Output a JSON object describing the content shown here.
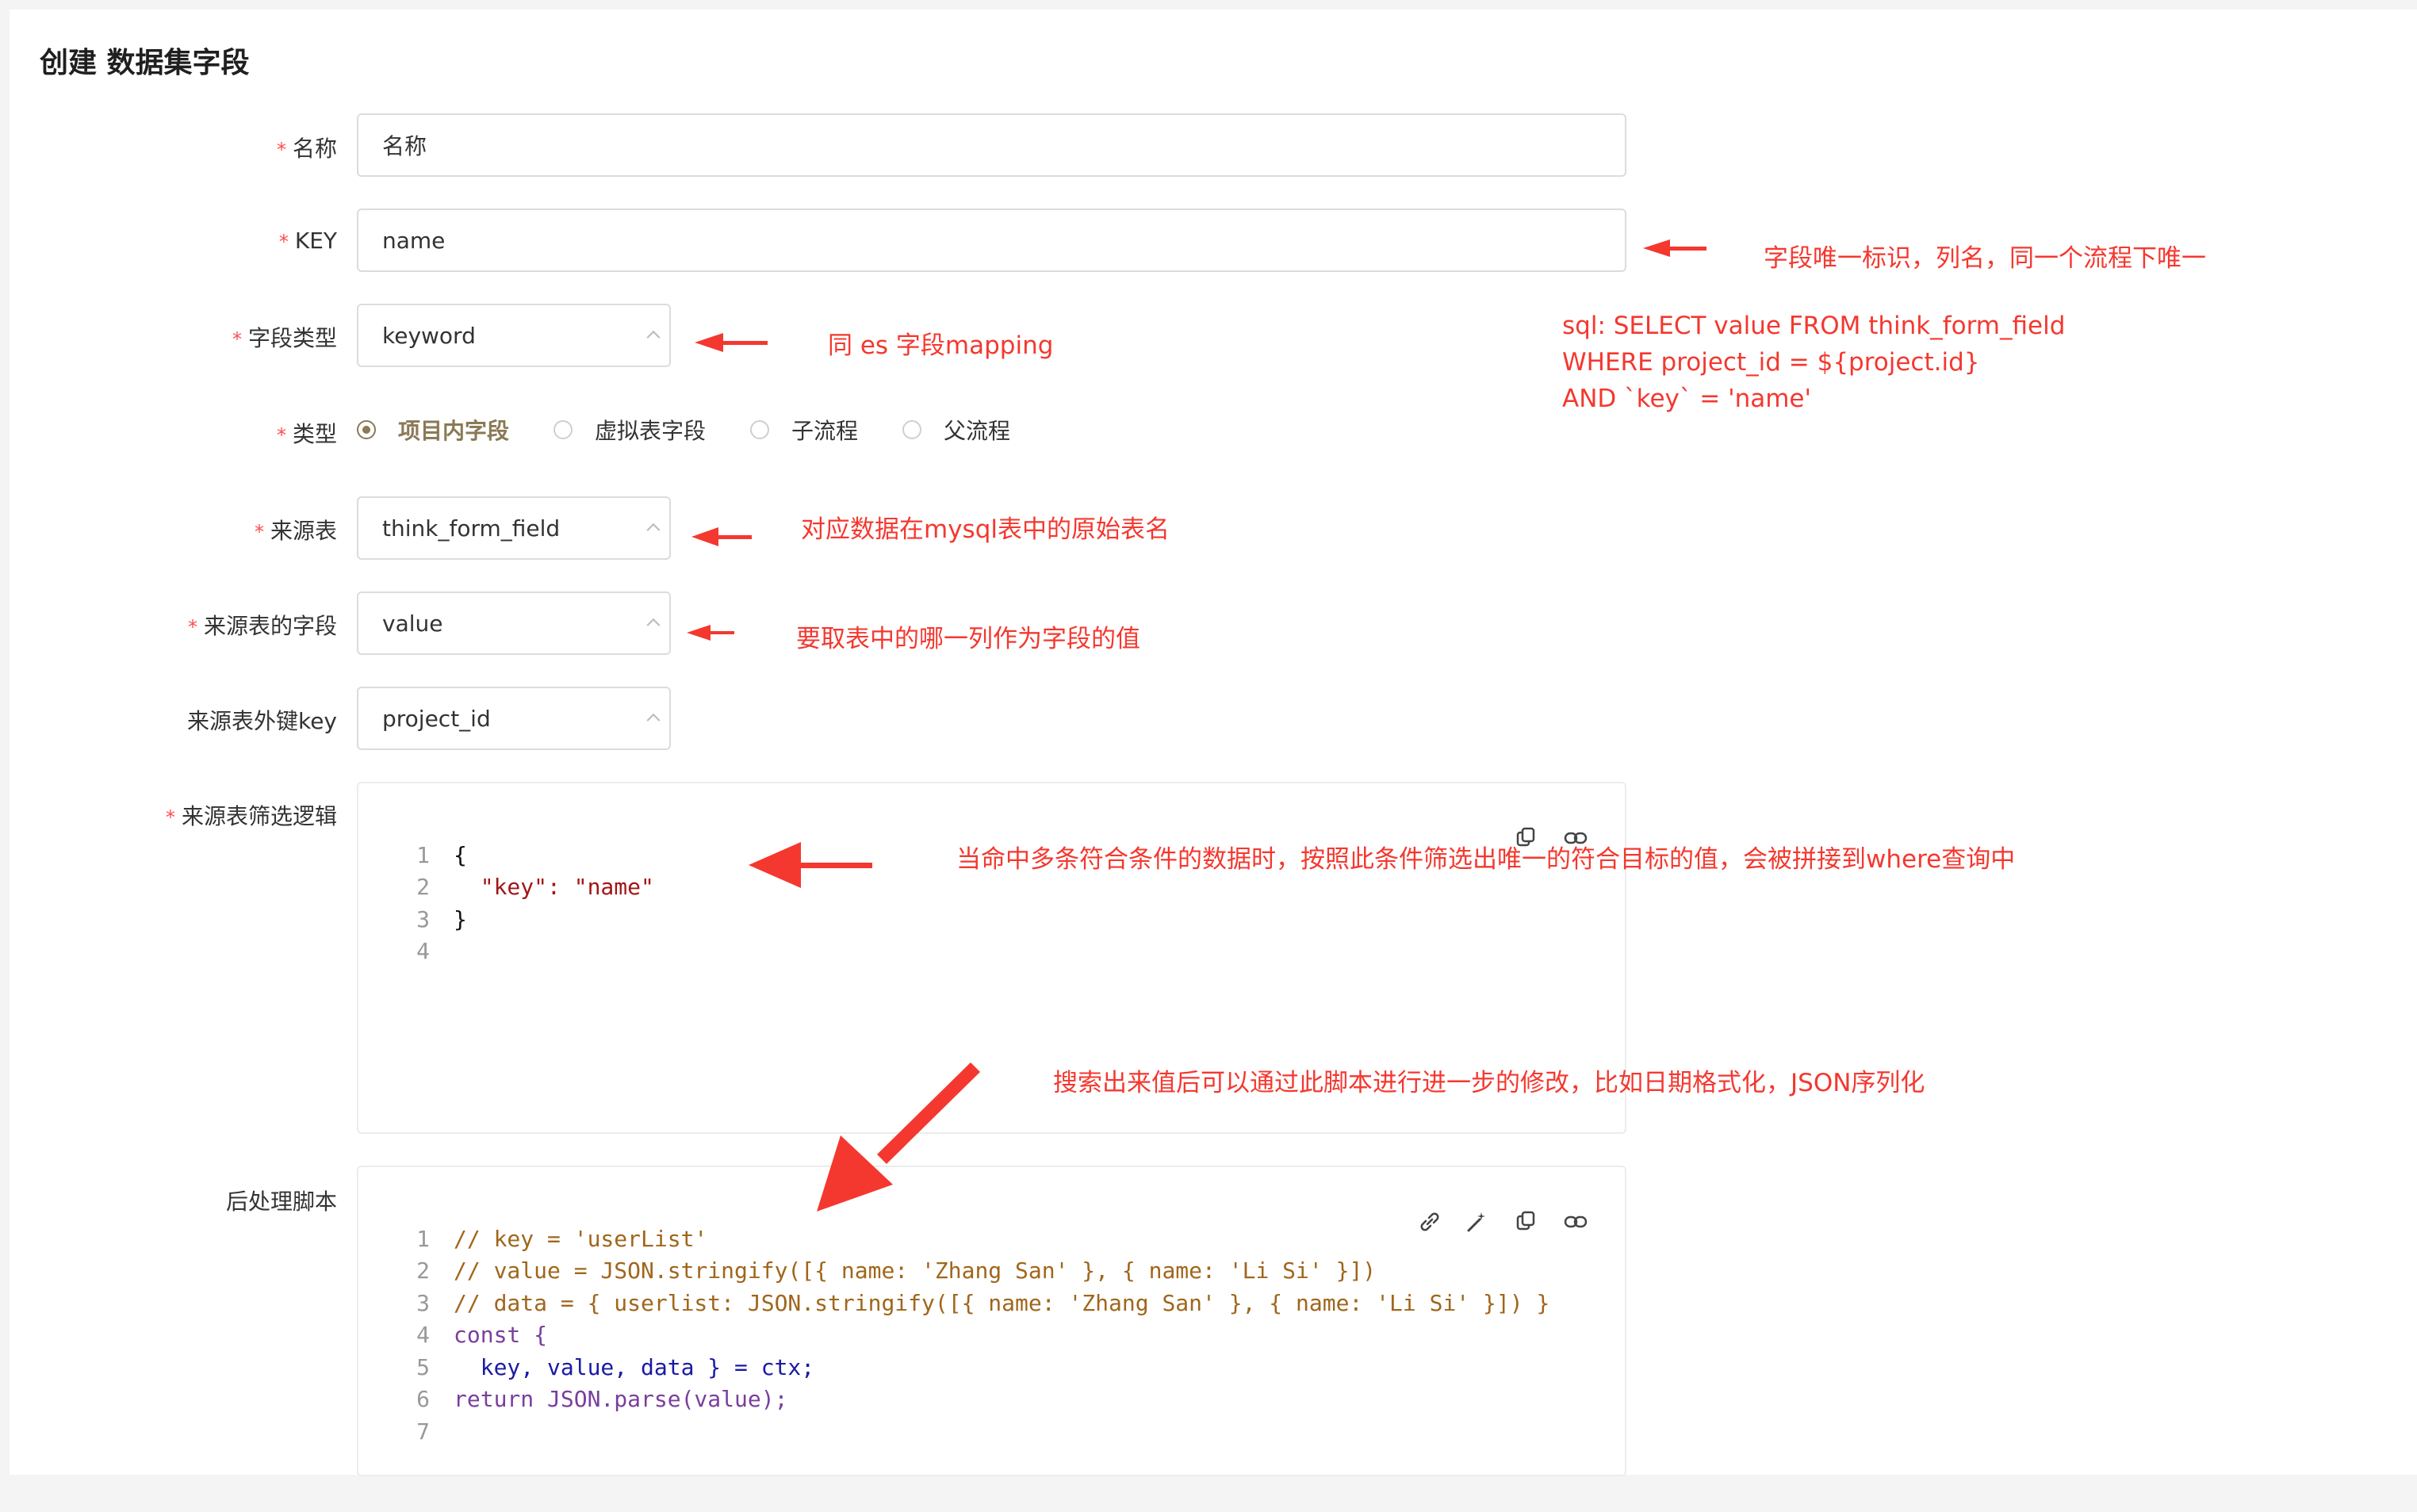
{
  "page": {
    "title": "创建 数据集字段"
  },
  "form": {
    "name": {
      "label": "名称",
      "required": true,
      "value": "名称"
    },
    "key": {
      "label": "KEY",
      "required": true,
      "value": "name"
    },
    "field_type": {
      "label": "字段类型",
      "required": true,
      "value": "keyword"
    },
    "type": {
      "label": "类型",
      "required": true,
      "options": [
        "项目内字段",
        "虚拟表字段",
        "子流程",
        "父流程"
      ],
      "selected": "项目内字段"
    },
    "source_table": {
      "label": "来源表",
      "required": true,
      "value": "think_form_field"
    },
    "source_field": {
      "label": "来源表的字段",
      "required": true,
      "value": "value"
    },
    "foreign_key": {
      "label": "来源表外键key",
      "required": false,
      "value": "project_id"
    },
    "filter_logic": {
      "label": "来源表筛选逻辑",
      "required": true,
      "line_numbers": [
        "1",
        "2",
        "3",
        "4"
      ],
      "lines": [
        "{",
        "  \"key\": \"name\"",
        "}",
        ""
      ]
    },
    "post_script": {
      "label": "后处理脚本",
      "required": false,
      "line_numbers": [
        "1",
        "2",
        "3",
        "4",
        "5",
        "6",
        "7"
      ],
      "lines": [
        "// key = 'userList'",
        "// value = JSON.stringify([{ name: 'Zhang San' }, { name: 'Li Si' }])",
        "// data = { userlist: JSON.stringify([{ name: 'Zhang San' }, { name: 'Li Si' }]) }",
        "const {",
        "  key, value, data } = ctx;",
        "return JSON.parse(value);",
        ""
      ]
    }
  },
  "annotations": {
    "key_note": "字段唯一标识，列名，同一个流程下唯一",
    "sql_lines": [
      "sql: SELECT value FROM think_form_field",
      "WHERE project_id = ${project.id}",
      "AND `key` = 'name'"
    ],
    "field_type_note": "同 es 字段mapping",
    "source_table_note": "对应数据在mysql表中的原始表名",
    "source_field_note": "要取表中的哪一列作为字段的值",
    "filter_note": "当命中多条符合条件的数据时，按照此条件筛选出唯一的符合目标的值，会被拼接到where查询中",
    "script_note": "搜索出来值后可以通过此脚本进行进一步的修改，比如日期格式化，JSON序列化"
  },
  "colors": {
    "accent": "#8a7a55",
    "annotation": "#f4382f",
    "required": "#ff4d4f"
  },
  "icons": [
    "link-icon",
    "magic-wand-icon",
    "copy-icon",
    "chain-icon"
  ]
}
